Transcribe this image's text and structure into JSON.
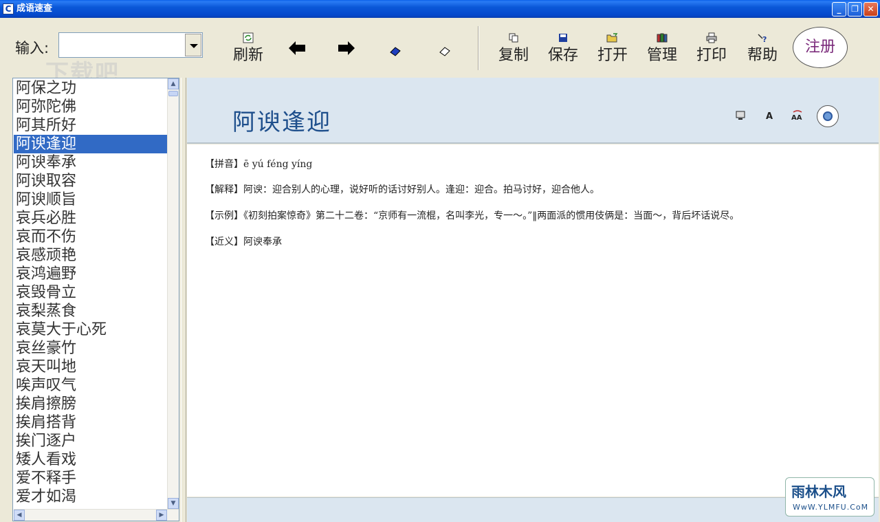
{
  "window": {
    "title": "成语速查",
    "app_icon": "C",
    "minimize": "_",
    "maximize": "❐",
    "close": "✕"
  },
  "toolbar": {
    "input_label": "输入:",
    "input_value": "",
    "refresh_label": "刷新",
    "copy_label": "复制",
    "save_label": "保存",
    "open_label": "打开",
    "manage_label": "管理",
    "print_label": "打印",
    "help_label": "帮助",
    "register_label": "注册",
    "icons": {
      "refresh": "refresh-icon",
      "back": "arrow-left-icon",
      "forward": "arrow-right-icon",
      "eraser": "eraser-icon",
      "clear": "clear-icon",
      "copy": "copy-icon",
      "save": "floppy-icon",
      "open": "folder-open-icon",
      "manage": "books-icon",
      "print": "printer-icon",
      "help": "help-icon"
    }
  },
  "idiom_list": {
    "selected_index": 3,
    "items": [
      "阿保之功",
      "阿弥陀佛",
      "阿其所好",
      "阿谀逢迎",
      "阿谀奉承",
      "阿谀取容",
      "阿谀顺旨",
      "哀兵必胜",
      "哀而不伤",
      "哀感顽艳",
      "哀鸿遍野",
      "哀毁骨立",
      "哀梨蒸食",
      "哀莫大于心死",
      "哀丝豪竹",
      "哀天叫地",
      "唉声叹气",
      "挨肩擦膀",
      "挨肩搭背",
      "挨门逐户",
      "矮人看戏",
      "爱不释手",
      "爱才如渴"
    ]
  },
  "detail": {
    "title": "阿谀逢迎",
    "header_icons": {
      "monitor": "monitor-icon",
      "font": "A",
      "font_size": "AA",
      "disc": "disc-icon"
    },
    "pinyin": "【拼音】ē yú féng yíng",
    "explanation": "【解释】阿谀：迎合别人的心理，说好听的话讨好别人。逢迎：迎合。拍马讨好，迎合他人。",
    "example": "【示例】《初刻拍案惊奇》第二十二卷：“京师有一流棍，名叫李光，专一～。”‖两面派的惯用伎俩是：当面～，背后坏话说尽。",
    "synonym": "【近义】阿谀奉承"
  },
  "watermarks": {
    "top_left": "下载吧",
    "bottom_right_title": "雨林木风",
    "bottom_right_url": "WwW.YLMFU.CoM"
  },
  "colors": {
    "titlebar": "#0548cc",
    "selection": "#316ac5",
    "detail_header_bg": "#dbe6f0",
    "idiom_title": "#1e4f8c",
    "register_text": "#7a2a7a"
  }
}
